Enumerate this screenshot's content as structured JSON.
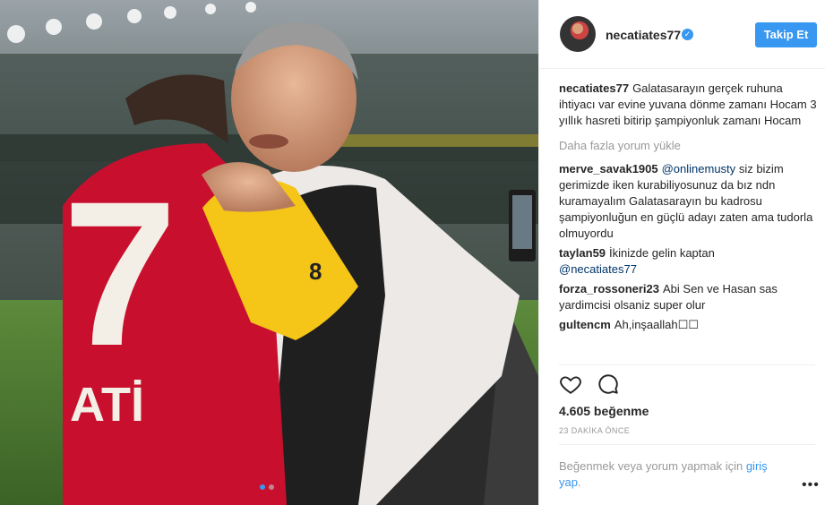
{
  "post": {
    "username": "necatiates77",
    "follow_label": "Takip Et",
    "caption": "Galatasarayın gerçek ruhuna ihtiyacı var evine yuvana dönme zamanı Hocam 3 yıllık hasreti bitirip şampiyonluk zamanı Hocam",
    "load_more": "Daha fazla yorum yükle",
    "comments": [
      {
        "user": "merve_savak1905",
        "mention": "@onlinemusty",
        "text": "siz bizim gerimizde iken kurabiliyosunuz da bız ndn kuramayalım Galatasarayın bu kadrosu şampiyonluğun en güçlü adayı zaten ama tudorla olmuyordu"
      },
      {
        "user": "taylan59",
        "text": "İkinizde gelin kaptan",
        "mention": "@necatiates77"
      },
      {
        "user": "forza_rossoneri23",
        "text": "Abi Sen ve Hasan sas yardimcisi olsaniz super olur"
      },
      {
        "user": "gultencm",
        "text": "Ah,inşaallah☐☐"
      }
    ],
    "likes": "4.605 beğenme",
    "time": "23 DAKİKA ÖNCE",
    "login_prefix": "Beğenmek veya yorum yapmak için",
    "login_link": "giriş yap",
    "more_label": "•••"
  },
  "photo": {
    "jersey_number": "7",
    "jersey_name": "ATİ",
    "sleeve_badge": "8"
  },
  "icons": {
    "verified": "verified-badge-icon",
    "like": "heart-icon",
    "comment": "comment-bubble-icon"
  },
  "colors": {
    "accent": "#3897f0",
    "jersey_red": "#c8102e",
    "jersey_yellow": "#f5c518"
  }
}
